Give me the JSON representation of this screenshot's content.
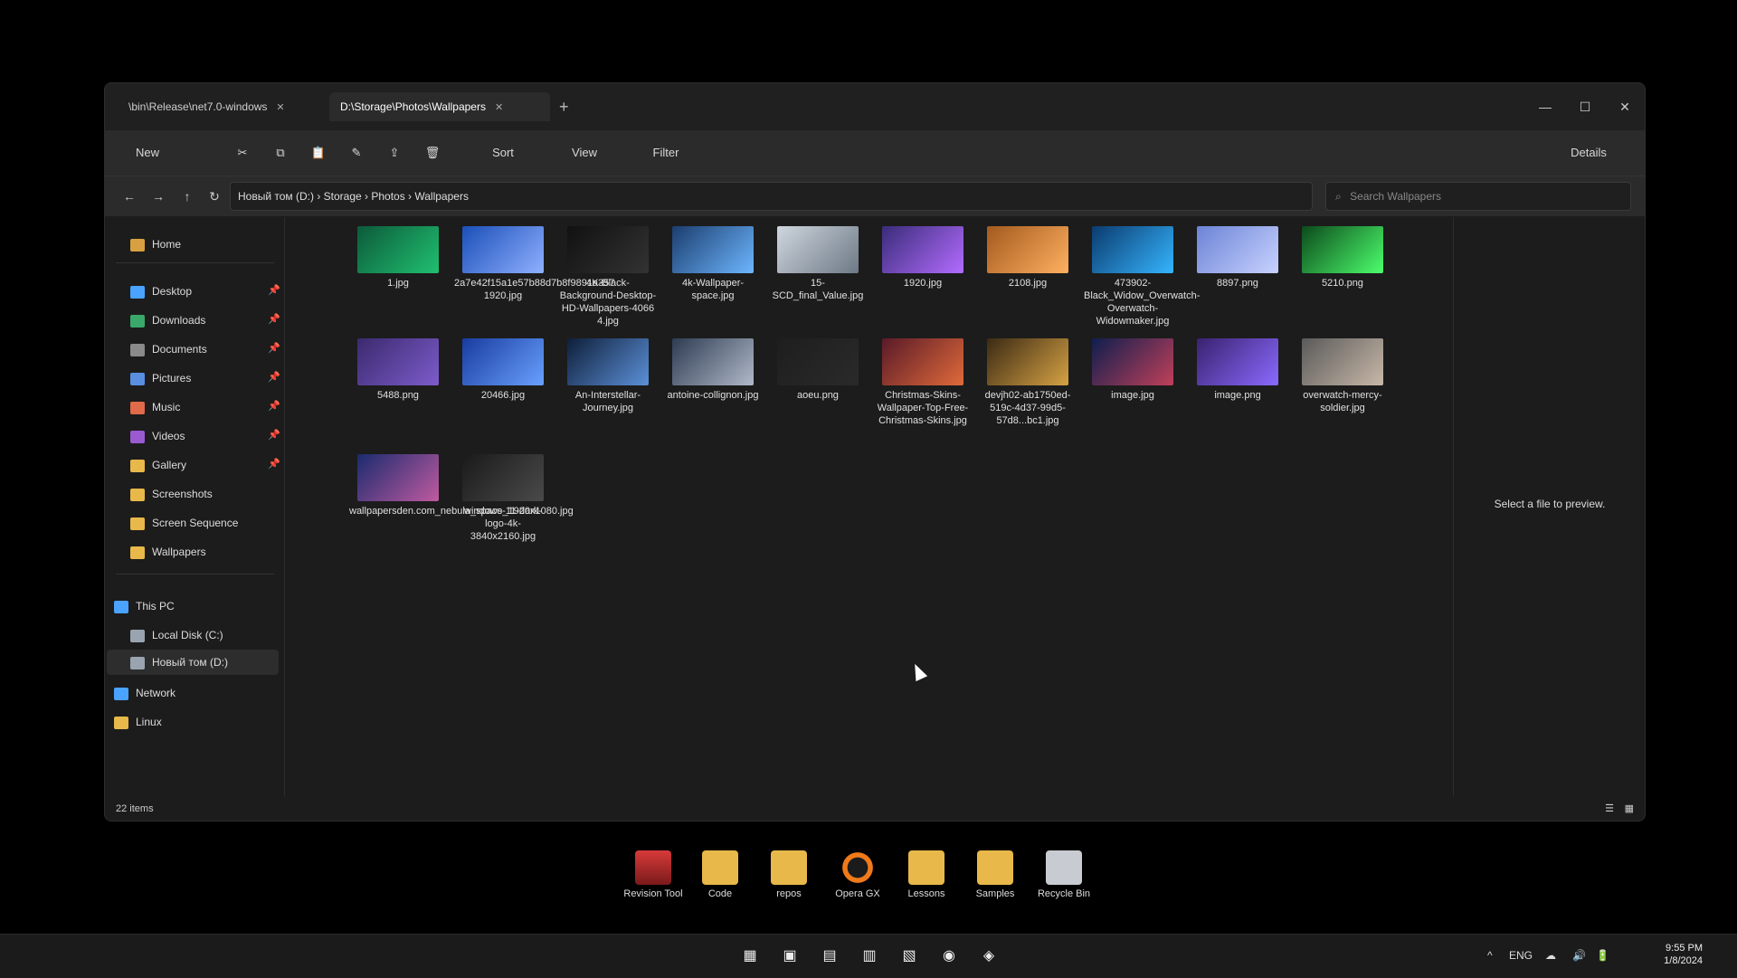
{
  "window": {
    "tabs": [
      {
        "label": "\\bin\\Release\\net7.0-windows"
      },
      {
        "label": "D:\\Storage\\Photos\\Wallpapers"
      }
    ],
    "newtab": "+",
    "controls": [
      "—",
      "☐",
      "✕"
    ]
  },
  "toolbar": {
    "new": "New",
    "cut": "✂",
    "copy": "⧉",
    "paste": "📋",
    "rename": "✎",
    "share": "⇪",
    "delete": "🗑",
    "sort": "Sort",
    "view": "View",
    "filter": "Filter",
    "more": "···",
    "details": "Details"
  },
  "addressbar": {
    "path": "Новый том (D:) › Storage › Photos › Wallpapers",
    "search_placeholder": "Search Wallpapers"
  },
  "sidebar": {
    "home": "Home",
    "quick": [
      {
        "label": "Desktop"
      },
      {
        "label": "Downloads"
      },
      {
        "label": "Documents"
      },
      {
        "label": "Pictures"
      },
      {
        "label": "Music"
      },
      {
        "label": "Videos"
      },
      {
        "label": "Gallery"
      },
      {
        "label": "Screenshots"
      },
      {
        "label": "Screen Sequence"
      },
      {
        "label": "Wallpapers"
      }
    ],
    "drives": [
      {
        "label": "This PC"
      },
      {
        "label": "Local Disk (C:)"
      },
      {
        "label": "Новый том (D:)"
      },
      {
        "label": "Network"
      },
      {
        "label": "Linux"
      }
    ]
  },
  "files": [
    {
      "name": "1.jpg",
      "c1": "#0c5a3a",
      "c2": "#20c070"
    },
    {
      "name": "2a7e42f15a1e57b88d7b8f9891a357 1920.jpg",
      "c1": "#1b4fb8",
      "c2": "#8fb0ff"
    },
    {
      "name": "4K-Black-Background-Desktop-HD-Wallpapers-4066 4.jpg",
      "c1": "#111",
      "c2": "#333"
    },
    {
      "name": "4k-Wallpaper-space.jpg",
      "c1": "#1b3d6e",
      "c2": "#6db6ff"
    },
    {
      "name": "15-SCD_final_Value.jpg",
      "c1": "#cfd6de",
      "c2": "#6d7986"
    },
    {
      "name": "1920.jpg",
      "c1": "#3a2c7a",
      "c2": "#b36cff"
    },
    {
      "name": "2108.jpg",
      "c1": "#a35a1e",
      "c2": "#ffb060"
    },
    {
      "name": "473902-Black_Widow_Overwatch-Overwatch-Widowmaker.jpg",
      "c1": "#0b3b6e",
      "c2": "#35b5ff"
    },
    {
      "name": "8897.png",
      "c1": "#6c84d6",
      "c2": "#c8d2ff"
    },
    {
      "name": "5210.png",
      "c1": "#0c4a1c",
      "c2": "#4cff6c"
    },
    {
      "name": "5488.png",
      "c1": "#3b2a6e",
      "c2": "#7d5ccc"
    },
    {
      "name": "20466.jpg",
      "c1": "#183c9e",
      "c2": "#69a0ff"
    },
    {
      "name": "An-Interstellar-Journey.jpg",
      "c1": "#0e1f3a",
      "c2": "#5c90d8"
    },
    {
      "name": "antoine-collignon.jpg",
      "c1": "#2d3b52",
      "c2": "#b0b9c8"
    },
    {
      "name": "aoeu.png",
      "c1": "#1e1e1e",
      "c2": "#2a2a2a"
    },
    {
      "name": "Christmas-Skins-Wallpaper-Top-Free-Christmas-Skins.jpg",
      "c1": "#5a1a28",
      "c2": "#e06a3a"
    },
    {
      "name": "devjh02-ab1750ed-519c-4d37-99d5-57d8...bc1.jpg",
      "c1": "#3b2a14",
      "c2": "#d6a244"
    },
    {
      "name": "image.jpg",
      "c1": "#0f1e4e",
      "c2": "#c0405a"
    },
    {
      "name": "image.png",
      "c1": "#3a2270",
      "c2": "#8a6aff"
    },
    {
      "name": "overwatch-mercy-soldier.jpg",
      "c1": "#5a5a5a",
      "c2": "#c8b8a8"
    },
    {
      "name": "wallpapersden.com_nebula_space_1920x1080.jpg",
      "c1": "#1a2b6e",
      "c2": "#c05aa0"
    },
    {
      "name": "windows-11-dark-logo-4k-3840x2160.jpg",
      "c1": "#1a1a1a",
      "c2": "#4a4a4a"
    }
  ],
  "preview": {
    "message": "Select a file to preview."
  },
  "status": {
    "count": "22 items"
  },
  "desktop": [
    {
      "label": "Revision Tool"
    },
    {
      "label": "Code"
    },
    {
      "label": "repos"
    },
    {
      "label": "Opera GX"
    },
    {
      "label": "Lessons"
    },
    {
      "label": "Samples"
    },
    {
      "label": "Recycle Bin"
    }
  ],
  "taskbar": {
    "apps": [
      "▦",
      "▣",
      "▤",
      "▥",
      "▧",
      "◉",
      "◈"
    ],
    "tray": [
      "^",
      "ENG",
      "☁",
      "🔊",
      "🔋"
    ],
    "time": "9:55 PM",
    "date": "1/8/2024"
  },
  "colors": {
    "accent": "#4aa3ff",
    "folder": "#e8b84a",
    "window_bg": "#1c1c1c"
  }
}
